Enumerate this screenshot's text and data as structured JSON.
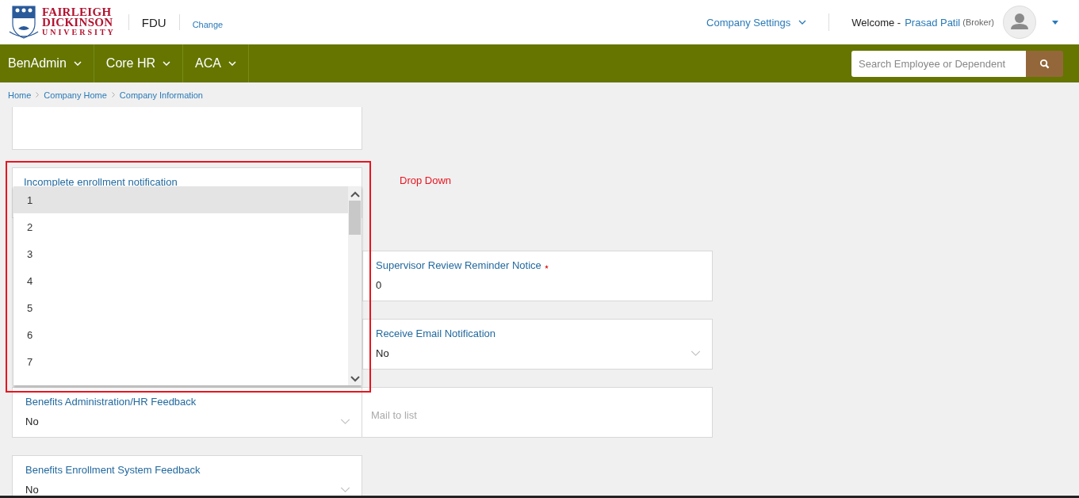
{
  "header": {
    "logo_lines": [
      "FAIRLEIGH",
      "DICKINSON",
      "UNIVERSITY"
    ],
    "company_code": "FDU",
    "change_link": "Change",
    "company_settings": "Company Settings",
    "welcome": "Welcome -",
    "user_name": "Prasad Patil",
    "user_role": "(Broker)"
  },
  "nav": {
    "menus": [
      {
        "label": "BenAdmin"
      },
      {
        "label": "Core HR"
      },
      {
        "label": "ACA"
      }
    ],
    "search": {
      "placeholder": "Search Employee or Dependent"
    }
  },
  "breadcrumb": [
    "Home",
    "Company Home",
    "Company Information"
  ],
  "dropdown_field": {
    "label": "Incomplete enrollment notification",
    "annotation": "Drop Down",
    "options": [
      {
        "label": "1",
        "selected": true
      },
      {
        "label": "2",
        "selected": false
      },
      {
        "label": "3",
        "selected": false
      },
      {
        "label": "4",
        "selected": false
      },
      {
        "label": "5",
        "selected": false
      },
      {
        "label": "6",
        "selected": false
      },
      {
        "label": "7",
        "selected": false
      }
    ]
  },
  "rows": [
    {
      "left": null,
      "right": {
        "kind": "number",
        "label": "Supervisor Review Reminder Notice",
        "required": true,
        "value": "0"
      }
    },
    {
      "left": null,
      "right": {
        "kind": "select",
        "label": "Receive Email Notification",
        "value": "No"
      }
    },
    {
      "left": {
        "kind": "select",
        "label": "Benefits Administration/HR Feedback",
        "value": "No"
      },
      "right": {
        "kind": "text",
        "placeholder": "Mail to list"
      }
    },
    {
      "left": {
        "kind": "select",
        "label": "Benefits Enrollment System Feedback",
        "value": "No"
      },
      "right": null
    }
  ]
}
